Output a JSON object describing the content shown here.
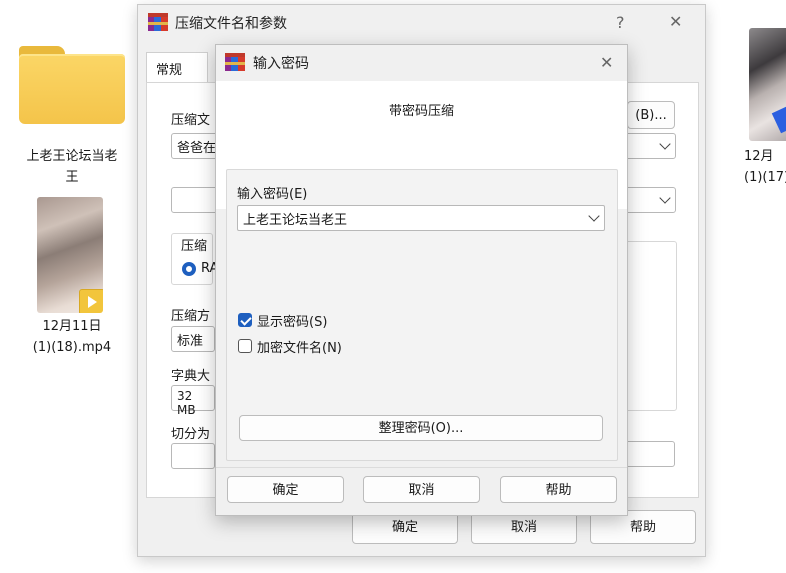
{
  "desktop": {
    "folder_label": "上老王论坛当老\n王",
    "video_left_label": "12月11日\n(1)(18).mp4",
    "video_right_label": "12月\n(1)(17)"
  },
  "back_window": {
    "title": "压缩文件名和参数",
    "help_symbol": "?",
    "close_symbol": "✕",
    "tab_general": "常规",
    "archive_name_label": "压缩文",
    "browse_button": "(B)...",
    "archive_name_value": "爸爸在",
    "format_group_label": "压缩",
    "format_option": "RA",
    "method_label": "压缩方",
    "method_value": "标准",
    "dict_label": "字典大",
    "dict_value": "32 MB",
    "split_label": "切分为",
    "ok_button": "确定",
    "cancel_button": "取消",
    "help_button": "帮助"
  },
  "front_dialog": {
    "title": "输入密码",
    "close_symbol": "✕",
    "heading": "带密码压缩",
    "password_label": "输入密码(E)",
    "password_value": "上老王论坛当老王",
    "show_password_label": "显示密码(S)",
    "show_password_checked": true,
    "encrypt_names_label": "加密文件名(N)",
    "encrypt_names_checked": false,
    "organize_button": "整理密码(O)...",
    "ok_button": "确定",
    "cancel_button": "取消",
    "help_button": "帮助"
  },
  "colors": {
    "accent": "#1e5fbf",
    "folder": "#f4c44a"
  }
}
